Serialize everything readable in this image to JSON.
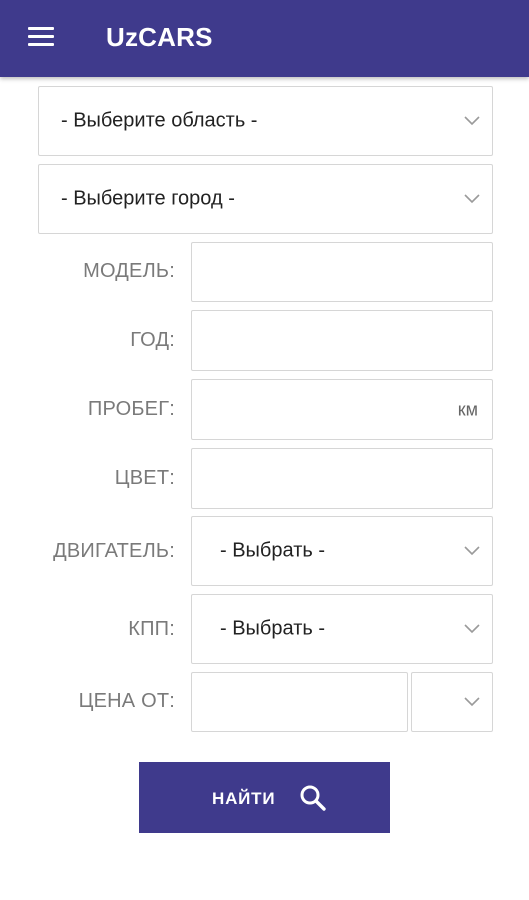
{
  "app": {
    "title": "UzCARS"
  },
  "filters": {
    "region_placeholder": "- Выберите область -",
    "city_placeholder": "- Выберите город -"
  },
  "fields": {
    "model_label": "МОДЕЛЬ:",
    "year_label": "ГОД:",
    "mileage_label": "ПРОБЕГ:",
    "mileage_unit": "км",
    "color_label": "ЦВЕТ:",
    "engine_label": "ДВИГАТЕЛЬ:",
    "engine_value": "- Выбрать -",
    "gearbox_label": "КПП:",
    "gearbox_value": "- Выбрать -",
    "price_label": "ЦЕНА ОТ:",
    "price_value": "",
    "currency_value": ""
  },
  "actions": {
    "search_label": "НАЙТИ"
  },
  "colors": {
    "primary": "#3f3a8c",
    "label": "#7a7a7a",
    "border": "#d6d6d6"
  },
  "icons": {
    "menu": "menu-icon",
    "dropdown": "chevron-down-icon",
    "search": "search-icon"
  }
}
